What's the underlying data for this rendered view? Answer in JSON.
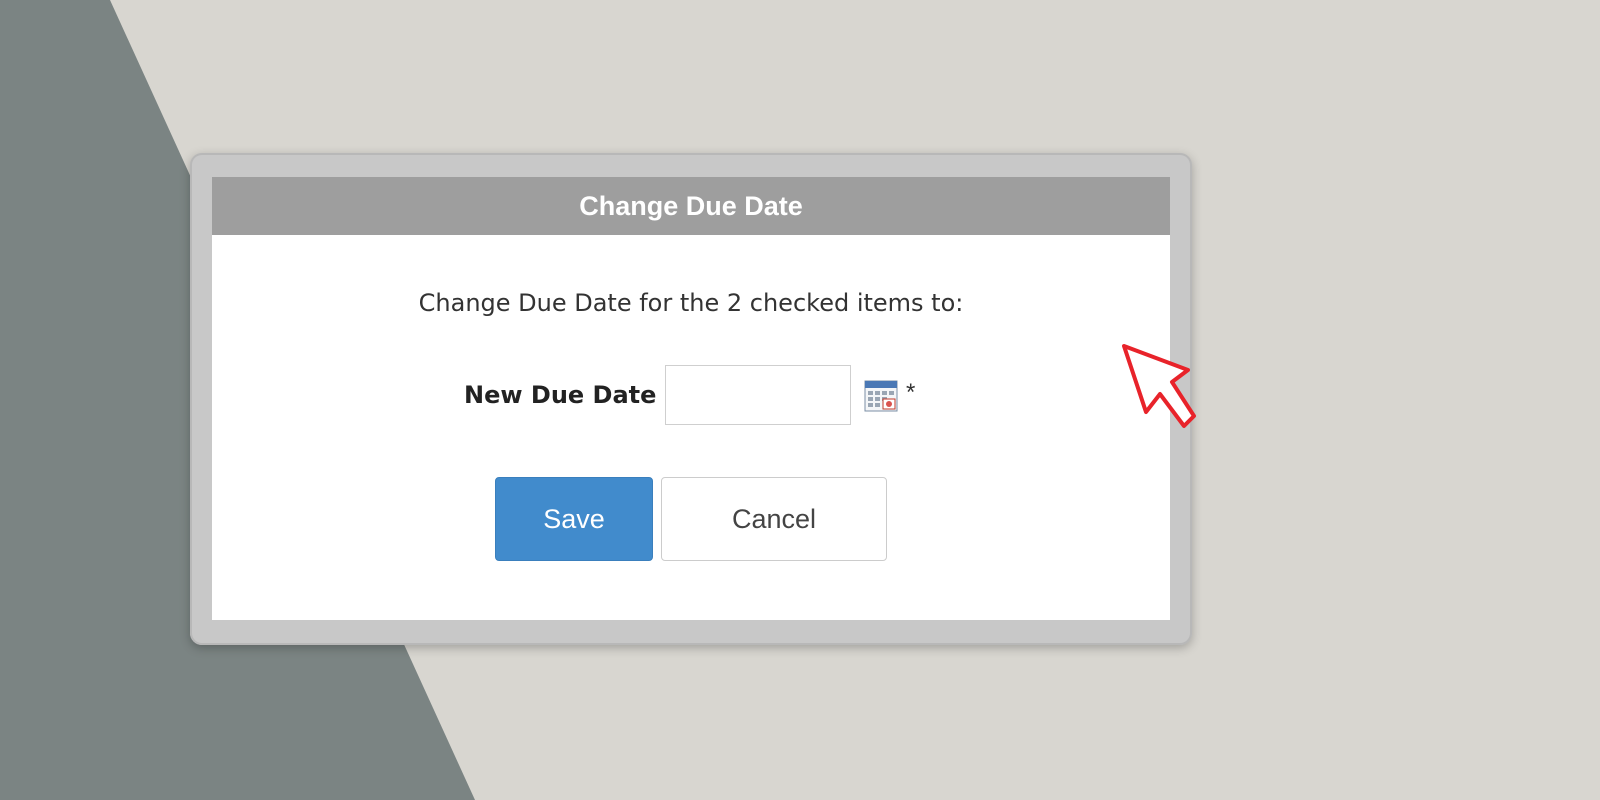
{
  "dialog": {
    "title": "Change Due Date",
    "message": "Change Due Date for the 2 checked items to:",
    "field": {
      "label": "New Due Date",
      "value": "",
      "placeholder": "",
      "required_marker": "*",
      "icon": "calendar-icon"
    },
    "buttons": {
      "save_label": "Save",
      "cancel_label": "Cancel"
    }
  },
  "colors": {
    "header_bg": "#9e9e9e",
    "save_button_bg": "#418bcc",
    "background_light": "#d8d6d0",
    "background_dark": "#7b8483",
    "cursor_outline": "#e8232a"
  }
}
